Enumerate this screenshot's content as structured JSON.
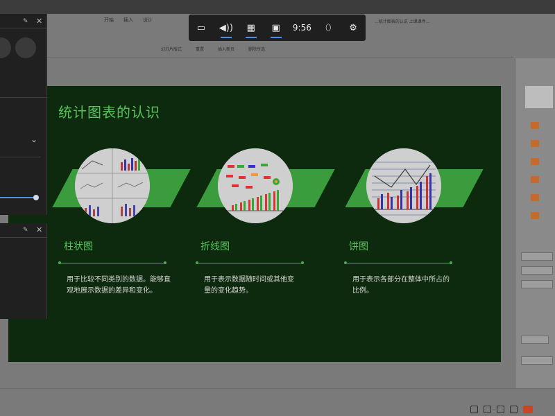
{
  "ribbon": {
    "tabs": [
      "开始",
      "插入",
      "设计"
    ],
    "doc_title": "...统计图表的认识 上课课件...",
    "sub_items": [
      "幻灯片版式",
      "重置",
      "插入新页",
      "删除所选"
    ]
  },
  "toolbar": {
    "time": "9:56"
  },
  "slide": {
    "title": "统计图表的认识",
    "sections": [
      {
        "name": "柱状图",
        "desc": "用于比较不同类别的数据。能够直观地展示数据的差异和变化。"
      },
      {
        "name": "折线图",
        "desc": "用于表示数据随时间或其他变量的变化趋势。"
      },
      {
        "name": "饼图",
        "desc": "用于表示各部分在整体中所占的比例。"
      }
    ]
  },
  "colors": {
    "slide_bg": "#0d2a0e",
    "accent_green": "#57c45a",
    "band_green": "#3a9c3c",
    "toolbar_bg": "#1f1f1f",
    "toolbar_active": "#4d8fe0"
  },
  "icons": {
    "toolbar": [
      "cast-icon",
      "volume-icon",
      "capture-icon",
      "display-icon",
      "mouse-icon",
      "settings-icon"
    ]
  }
}
